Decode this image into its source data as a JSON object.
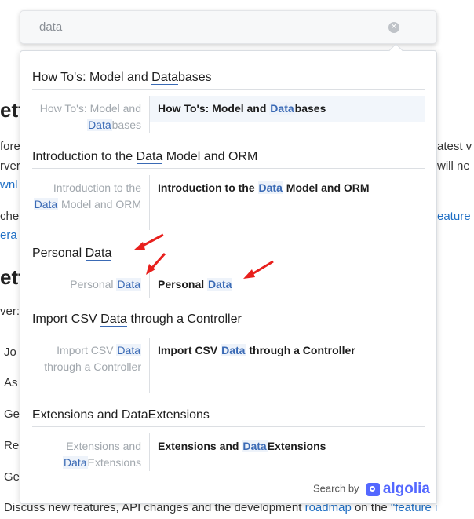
{
  "search": {
    "value": "data",
    "clear_icon": "clear-circle-icon"
  },
  "background": {
    "lines": [
      "ett",
      "fore",
      "rver",
      "wnl",
      "che",
      "era",
      "ett",
      "ver:",
      "Jo",
      "As",
      "Ge",
      "Re",
      "Ge",
      "atest v",
      "will ne",
      "eature",
      "Discuss new features, API changes and the development",
      "roadmap",
      "on the",
      "\"feature i"
    ]
  },
  "categories": [
    {
      "header": [
        "How To's: Model and ",
        "Data",
        "bases"
      ],
      "left": [
        "How To's: Model and ",
        "Data",
        "bases"
      ],
      "right": [
        "How To's: Model and ",
        "Data",
        "bases"
      ]
    },
    {
      "header": [
        "Introduction to the ",
        "Data",
        " Model and ORM"
      ],
      "left": [
        "Introduction to the ",
        "Data",
        " Model and ORM"
      ],
      "right": [
        "Introduction to the ",
        "Data",
        " Model and ORM"
      ]
    },
    {
      "header": [
        "Personal ",
        "Data",
        ""
      ],
      "left": [
        "Personal ",
        "Data",
        ""
      ],
      "right": [
        "Personal ",
        "Data",
        ""
      ]
    },
    {
      "header": [
        "Import CSV ",
        "Data",
        " through a Controller"
      ],
      "left": [
        "Import CSV ",
        "Data",
        " through a Controller"
      ],
      "right": [
        "Import CSV ",
        "Data",
        " through a Controller"
      ]
    },
    {
      "header": [
        "Extensions and ",
        "Data",
        "Extensions"
      ],
      "left": [
        "Extensions and ",
        "Data",
        "Extensions"
      ],
      "right": [
        "Extensions and ",
        "Data",
        "Extensions"
      ]
    }
  ],
  "footer": {
    "search_by": "Search by",
    "brand": "algolia",
    "brand_color": "#5468ff"
  },
  "annotation_color": "#e8201d"
}
